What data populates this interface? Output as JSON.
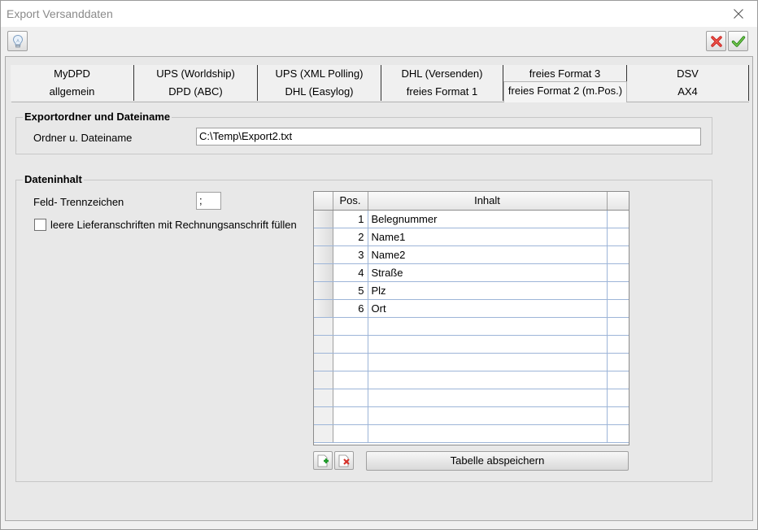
{
  "window": {
    "title": "Export Versanddaten"
  },
  "toolbar": {
    "hint_icon": "lightbulb-icon",
    "cancel_icon": "red-x-icon",
    "ok_icon": "green-check-icon"
  },
  "tabs": {
    "row1": [
      "MyDPD",
      "UPS (Worldship)",
      "UPS (XML Polling)",
      "DHL (Versenden)",
      "freies Format 3",
      "DSV"
    ],
    "row2": [
      "allgemein",
      "DPD (ABC)",
      "DHL (Easylog)",
      "freies Format 1",
      "freies Format 2 (m.Pos.)",
      "AX4"
    ],
    "active": "freies Format 2 (m.Pos.)"
  },
  "export": {
    "group_title": "Exportordner und Dateiname",
    "folder_label": "Ordner u. Dateiname",
    "folder_value": "C:\\Temp\\Export2.txt"
  },
  "content": {
    "group_title": "Dateninhalt",
    "separator_label": "Feld- Trennzeichen",
    "separator_value": ";",
    "fill_checkbox_label": "leere Lieferanschriften mit Rechnungsanschrift füllen",
    "fill_checkbox_checked": false
  },
  "grid": {
    "columns": [
      "",
      "Pos.",
      "Inhalt",
      ""
    ],
    "rows": [
      {
        "pos": "1",
        "inhalt": "Belegnummer"
      },
      {
        "pos": "2",
        "inhalt": "Name1"
      },
      {
        "pos": "3",
        "inhalt": "Name2"
      },
      {
        "pos": "4",
        "inhalt": "Straße"
      },
      {
        "pos": "5",
        "inhalt": "Plz"
      },
      {
        "pos": "6",
        "inhalt": "Ort"
      },
      {
        "pos": "",
        "inhalt": ""
      },
      {
        "pos": "",
        "inhalt": ""
      },
      {
        "pos": "",
        "inhalt": ""
      },
      {
        "pos": "",
        "inhalt": ""
      },
      {
        "pos": "",
        "inhalt": ""
      },
      {
        "pos": "",
        "inhalt": ""
      },
      {
        "pos": "",
        "inhalt": ""
      }
    ]
  },
  "buttons": {
    "add_row_icon": "add-row-icon",
    "delete_row_icon": "delete-row-icon",
    "save_table": "Tabelle abspeichern"
  },
  "colors": {
    "cancel": "#d9302b",
    "ok": "#3d9a2a",
    "grid_line": "#9db5d8"
  }
}
